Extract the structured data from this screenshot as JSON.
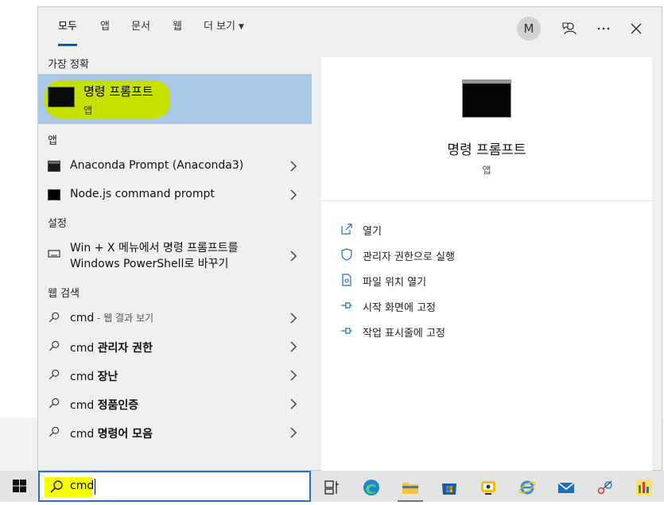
{
  "tabs": [
    {
      "label": "모두",
      "active": true
    },
    {
      "label": "앱"
    },
    {
      "label": "문서"
    },
    {
      "label": "웹"
    },
    {
      "label": "더 보기"
    }
  ],
  "header": {
    "avatar_initial": "M"
  },
  "sections": {
    "best": "가장 정확",
    "apps": "앱",
    "settings": "설정",
    "web": "웹 검색"
  },
  "best_match": {
    "title": "명령 프롬프트",
    "subtitle": "앱"
  },
  "apps": [
    {
      "label": "Anaconda Prompt (Anaconda3)"
    },
    {
      "label": "Node.js command prompt"
    }
  ],
  "settings": [
    {
      "line1": "Win + X 메뉴에서 명령 프롬프트를",
      "line2": "Windows PowerShell로 바꾸기"
    }
  ],
  "web": [
    {
      "query": "cmd",
      "suffix": " - 웹 결과 보기"
    },
    {
      "query": "cmd ",
      "bold": "관리자 권한"
    },
    {
      "query": "cmd ",
      "bold": "장난"
    },
    {
      "query": "cmd ",
      "bold": "정품인증"
    },
    {
      "query": "cmd ",
      "bold": "명령어 모음"
    }
  ],
  "detail": {
    "name": "명령 프롬프트",
    "kind": "앱",
    "actions": [
      {
        "label": "열기",
        "icon": "open-icon"
      },
      {
        "label": "관리자 권한으로 실행",
        "icon": "shield-icon"
      },
      {
        "label": "파일 위치 열기",
        "icon": "file-location-icon"
      },
      {
        "label": "시작 화면에 고정",
        "icon": "pin-icon"
      },
      {
        "label": "작업 표시줄에 고정",
        "icon": "pin-icon"
      }
    ]
  },
  "search": {
    "value": "cmd"
  },
  "colors": {
    "accent": "#0063b1",
    "selection": "#a8c8e6",
    "highlight": "#c6e000",
    "search_highlight": "#f6ff00"
  }
}
